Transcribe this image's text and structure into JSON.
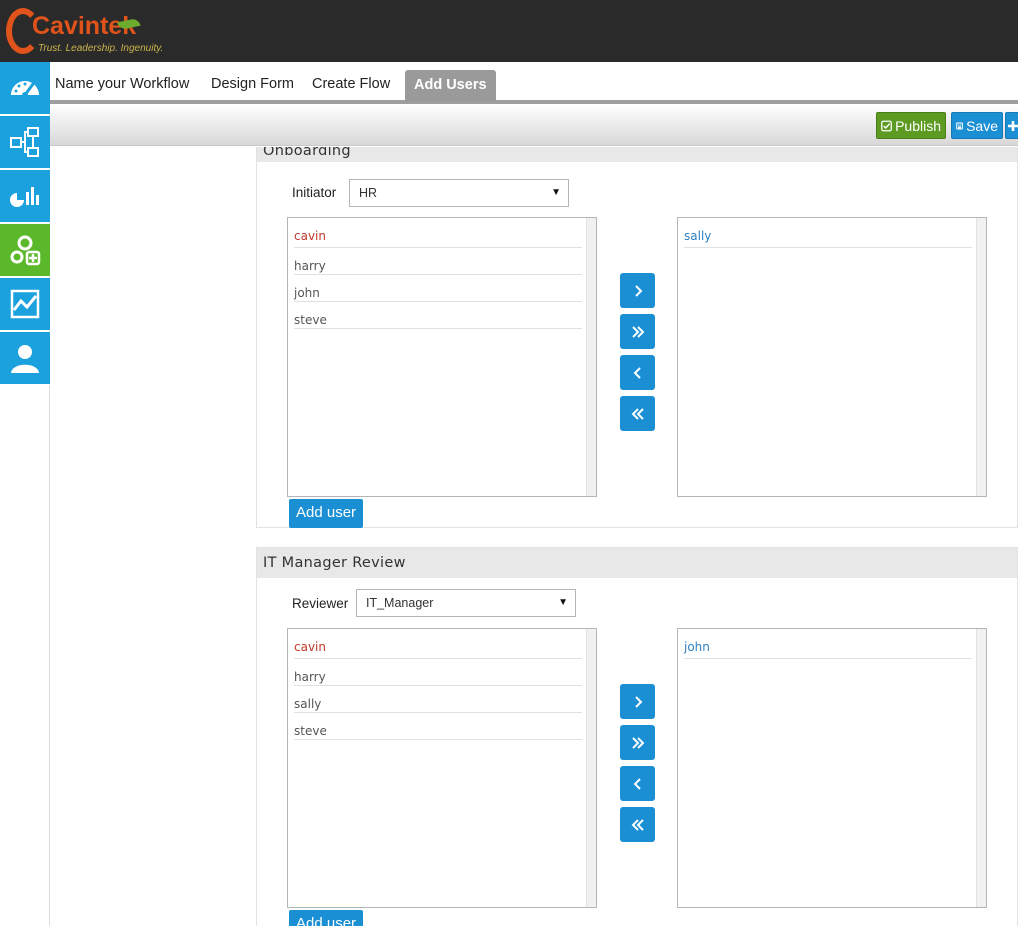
{
  "brand": {
    "name": "Cavintek",
    "tagline": "Trust. Leadership. Ingenuity."
  },
  "sidebar": {
    "items": [
      {
        "icon": "dashboard-gauge-icon",
        "active": false
      },
      {
        "icon": "workflow-flowchart-icon",
        "active": false
      },
      {
        "icon": "analytics-chart-icon",
        "active": false
      },
      {
        "icon": "settings-gears-plus-icon",
        "active": true
      },
      {
        "icon": "activity-graph-icon",
        "active": false
      },
      {
        "icon": "user-profile-icon",
        "active": false
      }
    ]
  },
  "tabs": [
    {
      "label": "Name your Workflow",
      "active": false
    },
    {
      "label": "Design Form",
      "active": false
    },
    {
      "label": "Create Flow",
      "active": false
    },
    {
      "label": "Add Users",
      "active": true
    }
  ],
  "toolbar": {
    "publish_label": "Publish",
    "save_label": "Save",
    "add_label": "+"
  },
  "colors": {
    "accent": "#1a8fd4",
    "active_nav": "#5cb82b",
    "publish": "#5d9a22",
    "brand_orange": "#e0531b",
    "header_bg": "#2a2a2a"
  },
  "panels": [
    {
      "title": "Onboarding",
      "role_label": "Initiator",
      "role_value": "HR",
      "available_users": [
        "cavin",
        "harry",
        "john",
        "steve"
      ],
      "assigned_users": [
        "sally"
      ],
      "add_user_label": "Add user"
    },
    {
      "title": "IT Manager Review",
      "role_label": "Reviewer",
      "role_value": "IT_Manager",
      "available_users": [
        "cavin",
        "harry",
        "sally",
        "steve"
      ],
      "assigned_users": [
        "john"
      ],
      "add_user_label": "Add user"
    }
  ]
}
